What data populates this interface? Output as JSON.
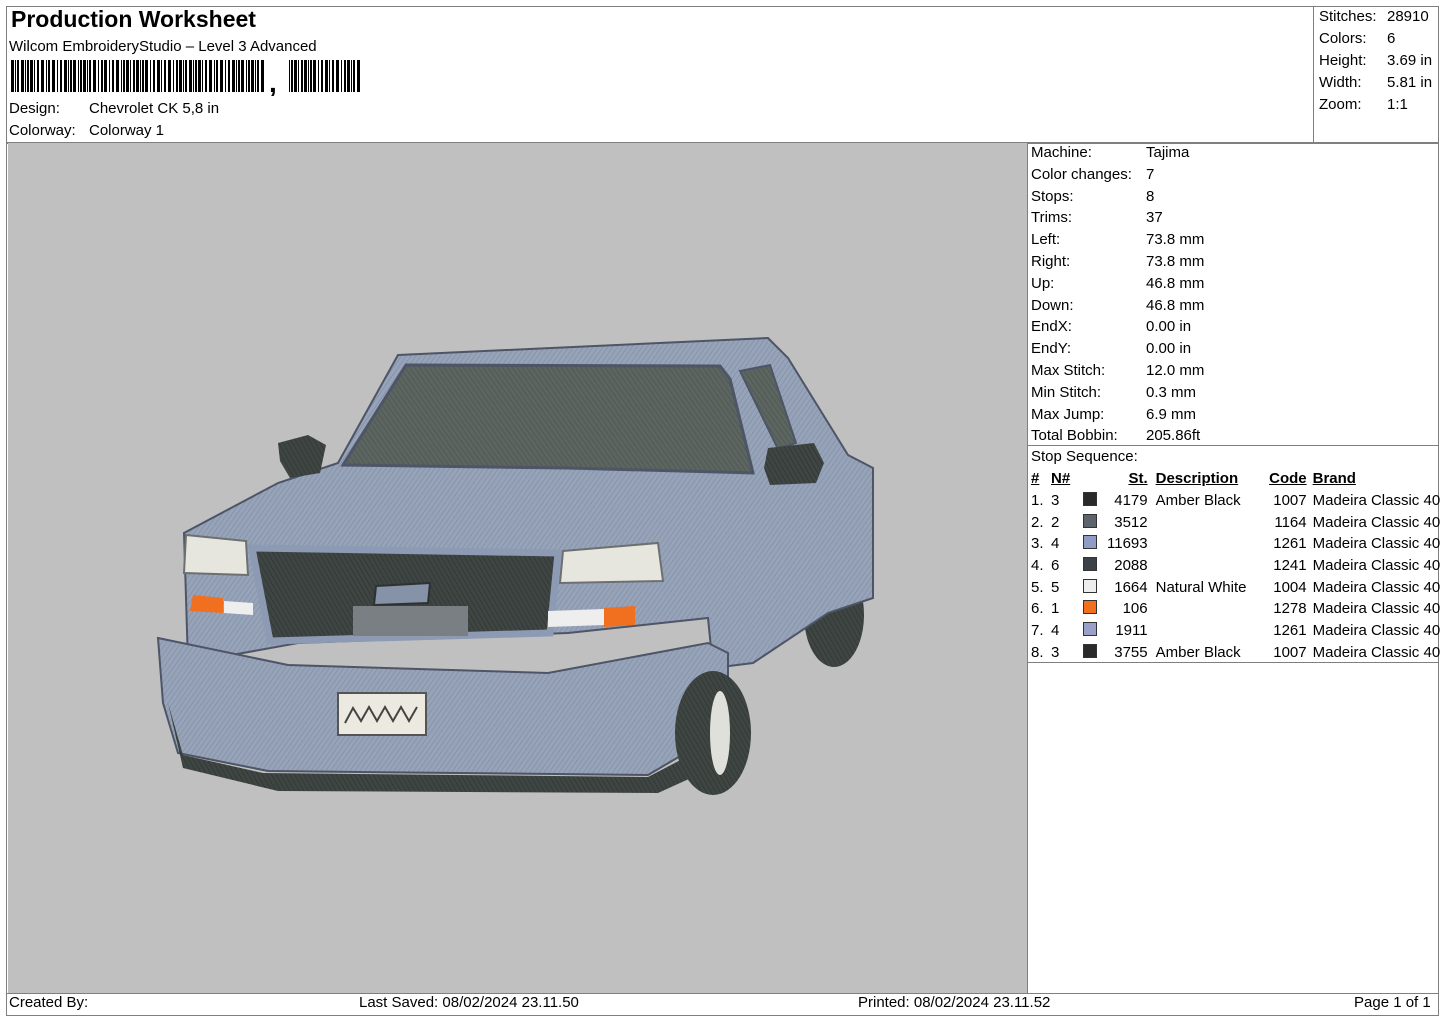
{
  "header": {
    "title": "Production Worksheet",
    "subtitle": "Wilcom EmbroideryStudio – Level 3 Advanced",
    "design_label": "Design:",
    "design_value": "Chevrolet CK 5,8 in",
    "colorway_label": "Colorway:",
    "colorway_value": "Colorway 1"
  },
  "summary": [
    {
      "label": "Stitches:",
      "value": "28910"
    },
    {
      "label": "Colors:",
      "value": "6"
    },
    {
      "label": "Height:",
      "value": "3.69 in"
    },
    {
      "label": "Width:",
      "value": "5.81 in"
    },
    {
      "label": "Zoom:",
      "value": "1:1"
    }
  ],
  "machine_info": [
    {
      "label": "Machine:",
      "value": "Tajima"
    },
    {
      "label": "Color changes:",
      "value": "7"
    },
    {
      "label": "Stops:",
      "value": "8"
    },
    {
      "label": "Trims:",
      "value": "37"
    },
    {
      "label": "Left:",
      "value": "73.8 mm"
    },
    {
      "label": "Right:",
      "value": "73.8 mm"
    },
    {
      "label": "Up:",
      "value": "46.8 mm"
    },
    {
      "label": "Down:",
      "value": "46.8 mm"
    },
    {
      "label": "EndX:",
      "value": "0.00 in"
    },
    {
      "label": "EndY:",
      "value": "0.00 in"
    },
    {
      "label": "Max Stitch:",
      "value": "12.0 mm"
    },
    {
      "label": "Min Stitch:",
      "value": "0.3 mm"
    },
    {
      "label": "Max Jump:",
      "value": "6.9 mm"
    },
    {
      "label": "Total Bobbin:",
      "value": "205.86ft"
    }
  ],
  "stop_sequence": {
    "title": "Stop Sequence:",
    "columns": {
      "num": "#",
      "n": "N#",
      "st": "St.",
      "description": "Description",
      "code": "Code",
      "brand": "Brand"
    },
    "rows": [
      {
        "num": "1.",
        "n": "3",
        "color": "#2a2a2a",
        "st": "4179",
        "description": "Amber Black",
        "code": "1007",
        "brand": "Madeira Classic 40"
      },
      {
        "num": "2.",
        "n": "2",
        "color": "#5e646c",
        "st": "3512",
        "description": "",
        "code": "1164",
        "brand": "Madeira Classic 40"
      },
      {
        "num": "3.",
        "n": "4",
        "color": "#8f9cc4",
        "st": "11693",
        "description": "",
        "code": "1261",
        "brand": "Madeira Classic 40"
      },
      {
        "num": "4.",
        "n": "6",
        "color": "#3c4147",
        "st": "2088",
        "description": "",
        "code": "1241",
        "brand": "Madeira Classic 40"
      },
      {
        "num": "5.",
        "n": "5",
        "color": "#eeeeee",
        "st": "1664",
        "description": "Natural White",
        "code": "1004",
        "brand": "Madeira Classic 40"
      },
      {
        "num": "6.",
        "n": "1",
        "color": "#f07020",
        "st": "106",
        "description": "",
        "code": "1278",
        "brand": "Madeira Classic 40"
      },
      {
        "num": "7.",
        "n": "4",
        "color": "#9aa0c8",
        "st": "1911",
        "description": "",
        "code": "1261",
        "brand": "Madeira Classic 40"
      },
      {
        "num": "8.",
        "n": "3",
        "color": "#2a2a2a",
        "st": "3755",
        "description": "Amber Black",
        "code": "1007",
        "brand": "Madeira Classic 40"
      }
    ]
  },
  "footer": {
    "created_by": "Created By:",
    "last_saved": "Last Saved: 08/02/2024 23.11.50",
    "printed": "Printed: 08/02/2024 23.11.52",
    "page": "Page 1 of 1"
  }
}
